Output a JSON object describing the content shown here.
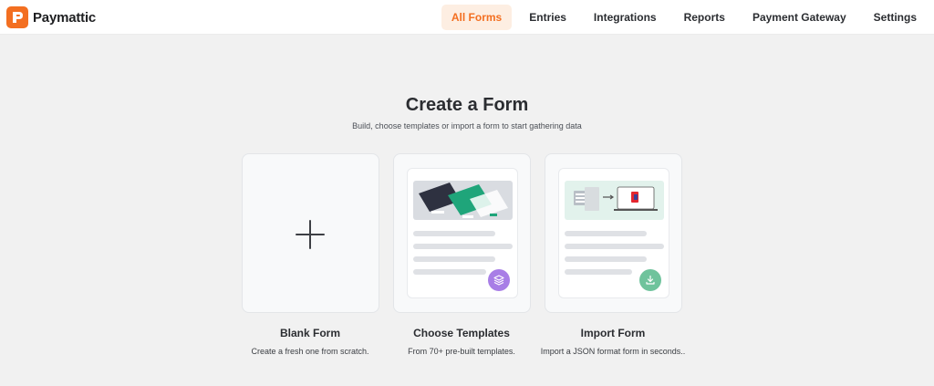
{
  "app": {
    "name": "Paymattic",
    "brand_color": "#f36f21"
  },
  "nav": {
    "items": [
      {
        "label": "All Forms",
        "active": true
      },
      {
        "label": "Entries"
      },
      {
        "label": "Integrations"
      },
      {
        "label": "Reports"
      },
      {
        "label": "Payment Gateway"
      },
      {
        "label": "Settings"
      }
    ]
  },
  "main": {
    "title": "Create a Form",
    "subtitle": "Build, choose templates or import a form to start gathering data",
    "options": [
      {
        "title": "Blank Form",
        "description": "Create a fresh one from scratch.",
        "icon": "plus-icon"
      },
      {
        "title": "Choose Templates",
        "description": "From 70+ pre-built templates.",
        "icon": "layers-icon",
        "badge_color": "#a87ee6"
      },
      {
        "title": "Import Form",
        "description": "Import a JSON format form in seconds..",
        "icon": "download-icon",
        "badge_color": "#6fc39c"
      }
    ]
  }
}
